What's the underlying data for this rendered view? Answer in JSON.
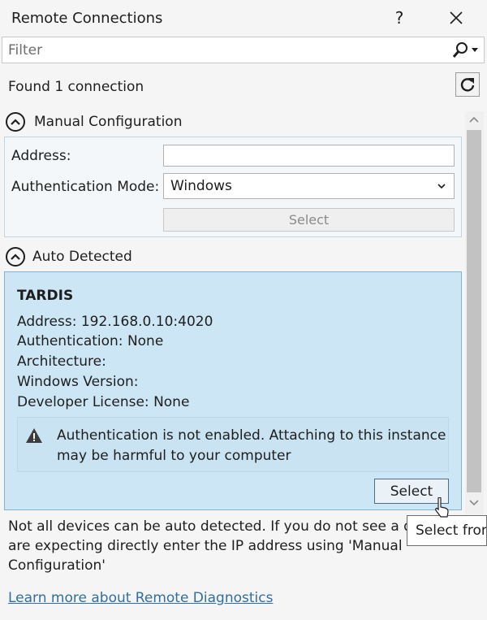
{
  "window": {
    "title": "Remote Connections",
    "help_label": "?",
    "close_label": "✕"
  },
  "filter": {
    "placeholder": "Filter",
    "value": ""
  },
  "status": {
    "found_text": "Found 1 connection"
  },
  "manual_config": {
    "title": "Manual Configuration",
    "address_label": "Address:",
    "address_value": "",
    "auth_mode_label": "Authentication Mode:",
    "auth_mode_selected": "Windows",
    "select_label": "Select"
  },
  "auto_detected": {
    "title": "Auto Detected",
    "device": {
      "name": "TARDIS",
      "address_label": "Address:",
      "address_value": "192.168.0.10:4020",
      "auth_label": "Authentication:",
      "auth_value": "None",
      "arch_label": "Architecture:",
      "arch_value": "",
      "winver_label": "Windows Version:",
      "winver_value": "",
      "devlicense_label": "Developer License:",
      "devlicense_value": "None"
    },
    "warning_text": "Authentication is not enabled. Attaching to this instance may be harmful to your computer",
    "select_label": "Select"
  },
  "note": {
    "text": "Not all devices can be auto detected. If you do not see a de",
    "text_line2": "are expecting directly enter the IP address using 'Manual",
    "text_line3": "Configuration'"
  },
  "tooltip": {
    "text": "Select from"
  },
  "footer": {
    "learn_more_label": "Learn more about Remote Diagnostics"
  },
  "colors": {
    "accent_blue": "#cde6f5",
    "panel_border": "#7fb3d5",
    "link": "#2f6fa3"
  },
  "icons": {
    "search": "search-icon",
    "refresh": "refresh-icon",
    "warning": "warning-icon",
    "collapse": "chevron-up-icon"
  }
}
